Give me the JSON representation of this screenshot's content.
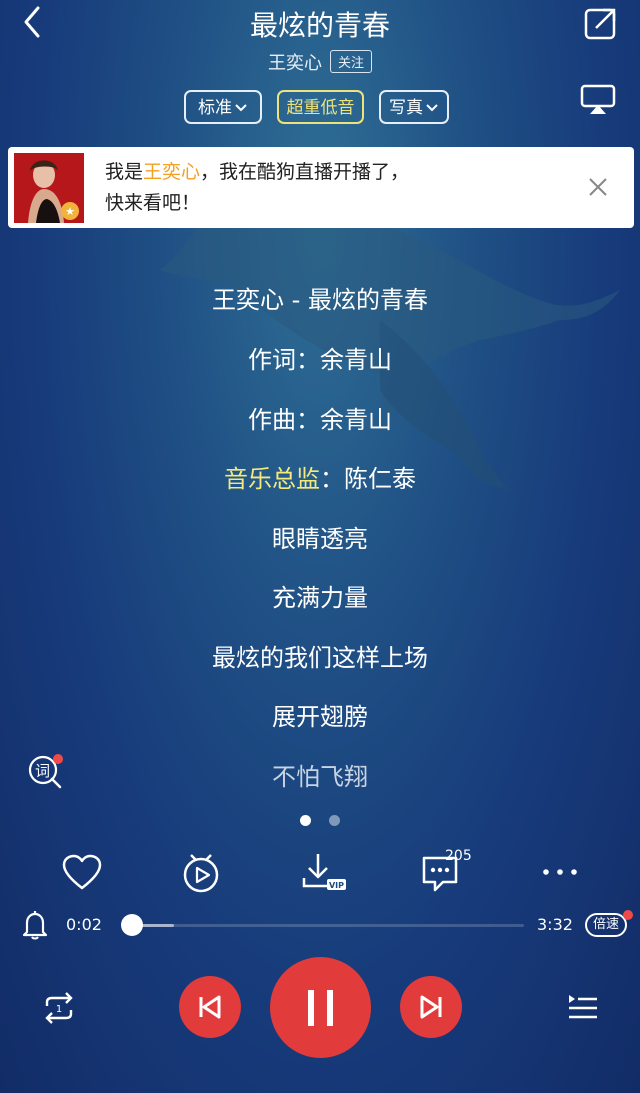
{
  "header": {
    "title": "最炫的青春",
    "artist": "王奕心",
    "follow_label": "关注"
  },
  "quality_pills": [
    {
      "label": "标准"
    },
    {
      "label": "超重低音"
    },
    {
      "label": "写真"
    }
  ],
  "banner": {
    "text_prefix": "我是",
    "text_highlight": "王奕心",
    "text_suffix": "，我在酷狗直播开播了，",
    "text_line2": "快来看吧！"
  },
  "lyrics": {
    "lines": [
      {
        "text": "王奕心 - 最炫的青春"
      },
      {
        "text": "作词：余青山"
      },
      {
        "text": "作曲：余青山"
      },
      {
        "text_highlight": "音乐总监",
        "text_rest": "：陈仁泰"
      },
      {
        "text": "眼睛透亮"
      },
      {
        "text": "充满力量"
      },
      {
        "text": "最炫的我们这样上场"
      },
      {
        "text": "展开翅膀"
      },
      {
        "text": "不怕飞翔"
      }
    ],
    "toggle_label": "词"
  },
  "pager": {
    "pages": 2,
    "active": 1
  },
  "actions": {
    "comment_count": "205",
    "download_badge": "VIP"
  },
  "playback": {
    "elapsed": "0:02",
    "duration": "3:32",
    "progress_fraction": 0.01,
    "speed_label": "倍速"
  },
  "colors": {
    "accent_red": "#e23b3b",
    "highlight_yellow": "#f3ea7b",
    "banner_highlight": "#f4a020"
  },
  "icons": {
    "back": "chevron-left-icon",
    "share": "share-icon",
    "cast": "airplay-icon",
    "like": "heart-icon",
    "video": "video-play-icon",
    "download": "download-icon",
    "comment": "comment-icon",
    "more": "more-icon",
    "alarm": "bell-icon",
    "repeat": "repeat-one-icon",
    "prev": "previous-icon",
    "pause": "pause-icon",
    "next": "next-icon",
    "playlist": "playlist-icon"
  }
}
